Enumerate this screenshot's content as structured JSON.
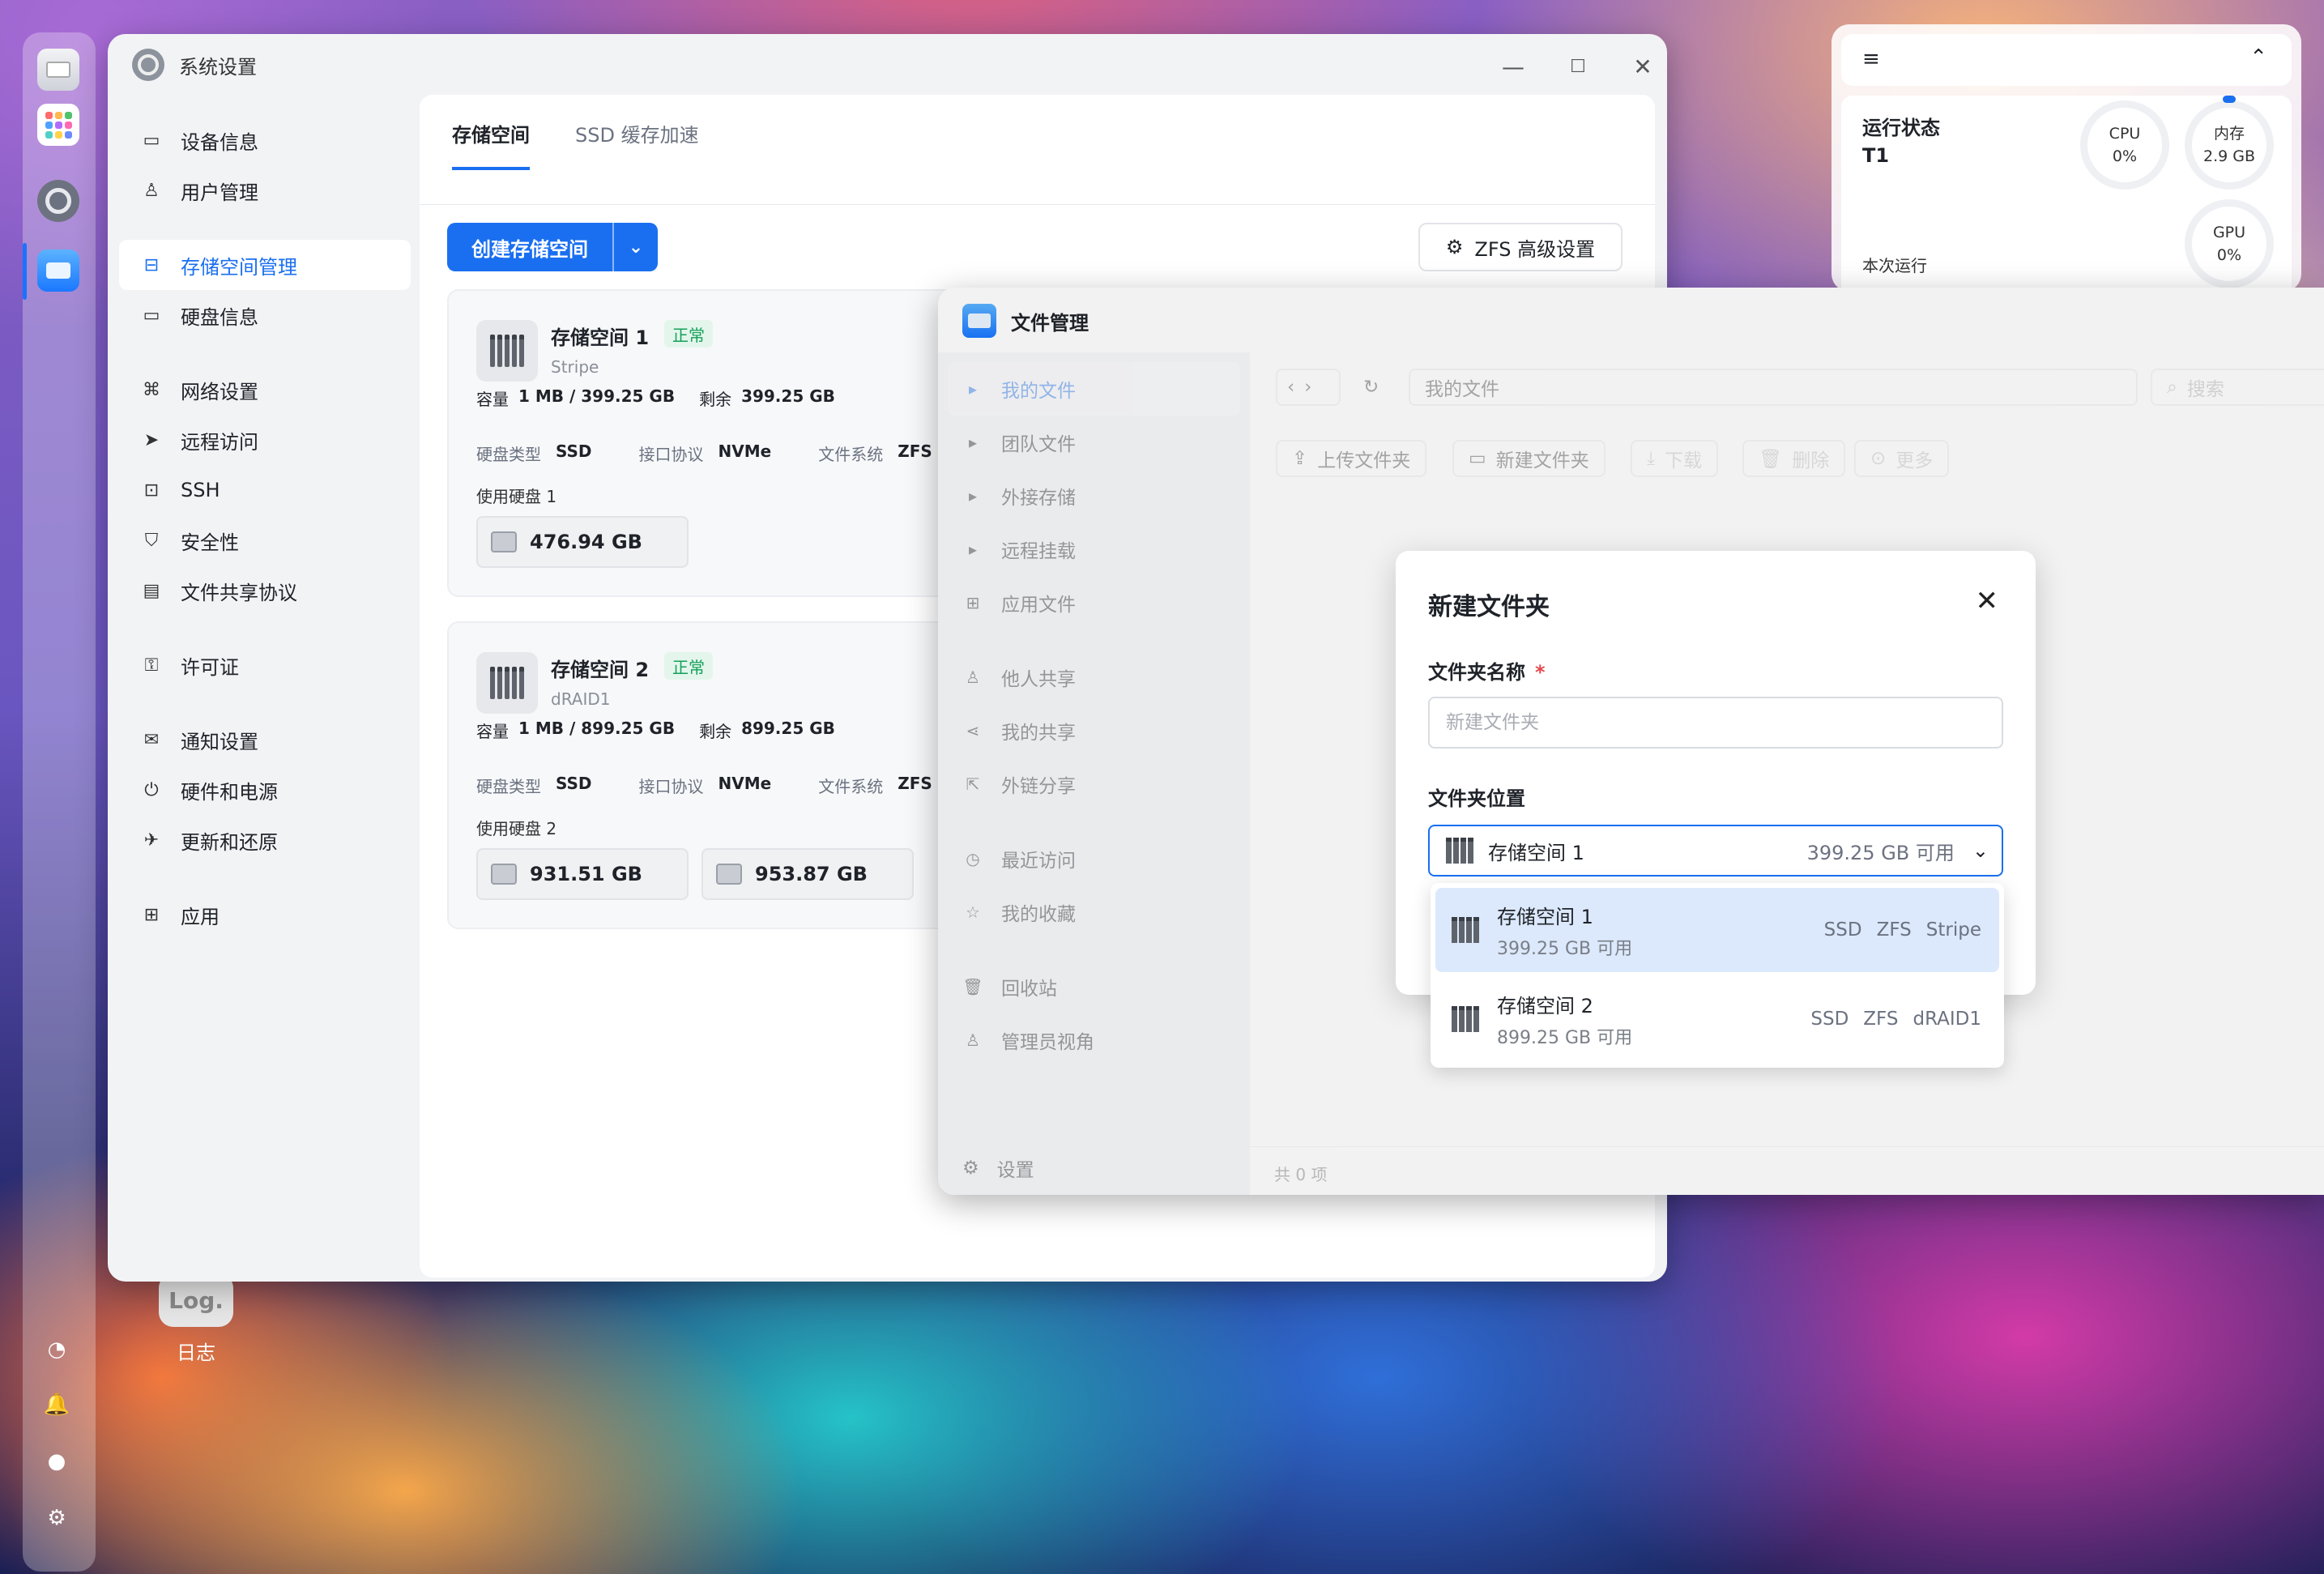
{
  "desktop": {
    "log_icon_text": "Log.",
    "log_label": "日志"
  },
  "settings": {
    "title": "系统设置",
    "sidebar": [
      {
        "label": "设备信息",
        "icon": "hdd-icon"
      },
      {
        "label": "用户管理",
        "icon": "user-icon"
      },
      {
        "label": "存储空间管理",
        "icon": "storage-icon",
        "active": true
      },
      {
        "label": "硬盘信息",
        "icon": "disk-icon"
      },
      {
        "label": "网络设置",
        "icon": "network-icon"
      },
      {
        "label": "远程访问",
        "icon": "send-icon"
      },
      {
        "label": "SSH",
        "icon": "terminal-icon"
      },
      {
        "label": "安全性",
        "icon": "shield-icon"
      },
      {
        "label": "文件共享协议",
        "icon": "document-icon"
      },
      {
        "label": "许可证",
        "icon": "key-icon"
      },
      {
        "label": "通知设置",
        "icon": "mail-icon"
      },
      {
        "label": "硬件和电源",
        "icon": "power-icon"
      },
      {
        "label": "更新和还原",
        "icon": "rocket-icon"
      },
      {
        "label": "应用",
        "icon": "apps-icon"
      }
    ],
    "tabs": [
      "存储空间",
      "SSD 缓存加速"
    ],
    "create_button": "创建存储空间",
    "zfs_button": "ZFS 高级设置",
    "pools": [
      {
        "name": "存储空间 1",
        "status": "正常",
        "layout": "Stripe",
        "cap_label": "容量",
        "capacity": "1 MB / 399.25 GB",
        "free_label": "剩余",
        "free": "399.25 GB",
        "disk_type_label": "硬盘类型",
        "disk_type": "SSD",
        "protocol_label": "接口协议",
        "protocol": "NVMe",
        "fs_label": "文件系统",
        "fs": "ZFS",
        "used_label": "使用硬盘 1",
        "disks": [
          "476.94 GB"
        ]
      },
      {
        "name": "存储空间 2",
        "status": "正常",
        "layout": "dRAID1",
        "cap_label": "容量",
        "capacity": "1 MB / 899.25 GB",
        "free_label": "剩余",
        "free": "899.25 GB",
        "disk_type_label": "硬盘类型",
        "disk_type": "SSD",
        "protocol_label": "接口协议",
        "protocol": "NVMe",
        "fs_label": "文件系统",
        "fs": "ZFS",
        "used_label": "使用硬盘 2",
        "disks": [
          "931.51 GB",
          "953.87 GB"
        ]
      }
    ]
  },
  "widget": {
    "title": "运行状态",
    "device": "T1",
    "runtime_label": "本次运行",
    "cpu_label": "CPU",
    "cpu_value": "0%",
    "mem_label": "内存",
    "mem_value": "2.9 GB",
    "gpu_label": "GPU",
    "gpu_value": "0%"
  },
  "file_manager": {
    "title": "文件管理",
    "sidebar": [
      {
        "label": "我的文件",
        "active": true
      },
      {
        "label": "团队文件"
      },
      {
        "label": "外接存储"
      },
      {
        "label": "远程挂载"
      },
      {
        "label": "应用文件"
      },
      {
        "label": "他人共享"
      },
      {
        "label": "我的共享"
      },
      {
        "label": "外链分享"
      },
      {
        "label": "最近访问"
      },
      {
        "label": "我的收藏"
      },
      {
        "label": "回收站"
      },
      {
        "label": "管理员视角"
      }
    ],
    "settings_label": "设置",
    "path": "我的文件",
    "search_placeholder": "搜索",
    "toolbar": [
      "上传文件夹",
      "新建文件夹",
      "下载",
      "删除",
      "更多"
    ],
    "footer": "共 0 项"
  },
  "dialog": {
    "title": "新建文件夹",
    "name_label": "文件夹名称",
    "required_mark": "*",
    "name_placeholder": "新建文件夹",
    "location_label": "文件夹位置",
    "selected": {
      "name": "存储空间 1",
      "available": "399.25 GB 可用"
    },
    "options": [
      {
        "name": "存储空间 1",
        "available": "399.25 GB 可用",
        "tags": [
          "SSD",
          "ZFS",
          "Stripe"
        ],
        "selected": true
      },
      {
        "name": "存储空间 2",
        "available": "899.25 GB 可用",
        "tags": [
          "SSD",
          "ZFS",
          "dRAID1"
        ]
      }
    ]
  }
}
